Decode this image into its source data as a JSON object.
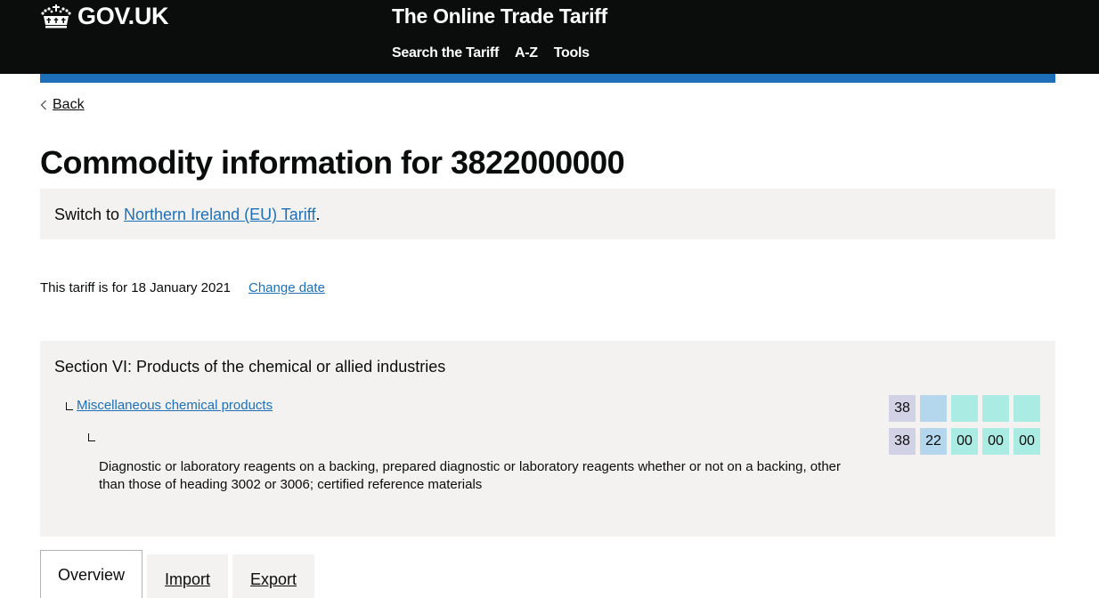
{
  "header": {
    "logo_text": "GOV.UK",
    "logo_icon": "crown-icon",
    "service_name": "The Online Trade Tariff",
    "nav": [
      {
        "label": "Search the Tariff"
      },
      {
        "label": "A-Z"
      },
      {
        "label": "Tools"
      }
    ],
    "accent_color": "#1d70b8"
  },
  "back_link": {
    "label": "Back",
    "icon": "chevron-left-icon"
  },
  "page_title": "Commodity information for 3822000000",
  "switch_panel": {
    "prefix": "Switch to ",
    "link": "Northern Ireland (EU) Tariff",
    "suffix": "."
  },
  "date_row": {
    "text": "This tariff is for 18 January 2021",
    "change_link": "Change date"
  },
  "section": {
    "title": "Section VI: Products of the chemical or allied industries",
    "chapter_link": "Miscellaneous chemical products",
    "description": "Diagnostic or laboratory reagents on a backing, prepared diagnostic or laboratory reagents whether or not on a backing, other than those of heading 3002 or 3006; certified reference materials",
    "chapter_code": [
      "38",
      "",
      "",
      "",
      ""
    ],
    "commodity_code": [
      "38",
      "22",
      "00",
      "00",
      "00"
    ],
    "code_colors": {
      "chapter": "#d2d2e6",
      "heading": "#b4d7ee",
      "subheading": "#aaebe4"
    }
  },
  "tabs": [
    {
      "label": "Overview",
      "active": true
    },
    {
      "label": "Import",
      "active": false
    },
    {
      "label": "Export",
      "active": false
    }
  ]
}
